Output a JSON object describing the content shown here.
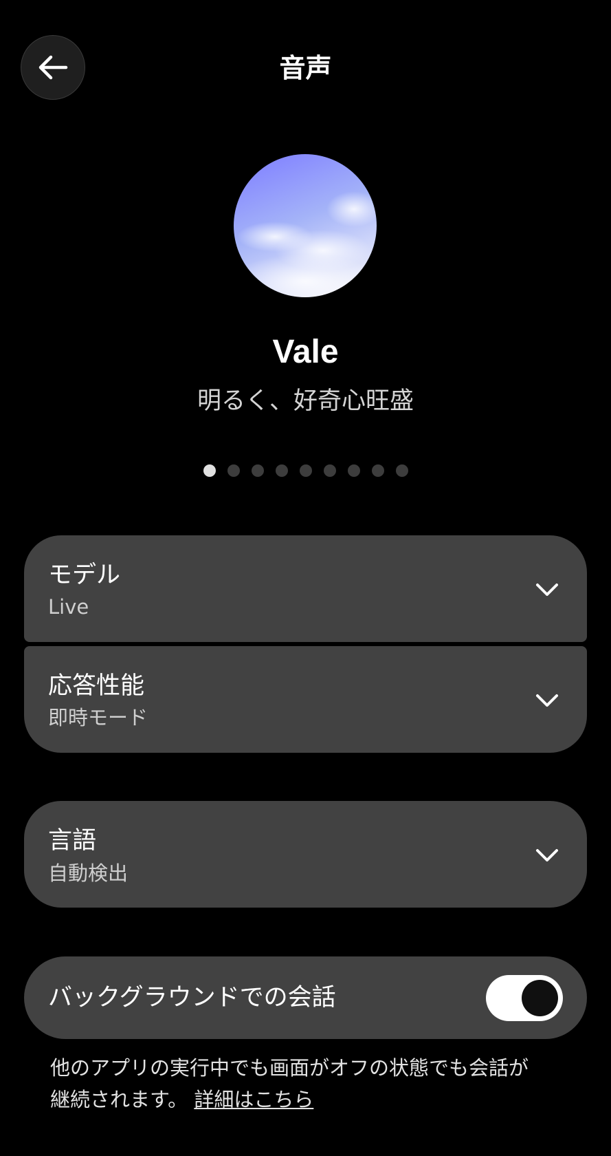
{
  "header": {
    "title": "音声",
    "back_icon": "arrow-left-icon"
  },
  "voice": {
    "name": "Vale",
    "description": "明るく、好奇心旺盛",
    "avatar_colors": [
      "#8a8cff",
      "#a9b4fa",
      "#eef0fb"
    ]
  },
  "carousel": {
    "total": 9,
    "active_index": 0
  },
  "settings": {
    "model": {
      "label": "モデル",
      "value": "Live"
    },
    "response": {
      "label": "応答性能",
      "value": "即時モード"
    },
    "language": {
      "label": "言語",
      "value": "自動検出"
    },
    "background": {
      "label": "バックグラウンドでの会話",
      "enabled": true
    }
  },
  "footnote": {
    "line1": "他のアプリの実行中でも画面がオフの状態でも会話が",
    "line2": "継続されます。",
    "link": "詳細はこちら"
  },
  "colors": {
    "background": "#000000",
    "card": "#424242",
    "toggle_track": "#ffffff",
    "toggle_knob": "#101010",
    "dot_active": "#e0e0e0",
    "dot_inactive": "#3d3d3d"
  }
}
